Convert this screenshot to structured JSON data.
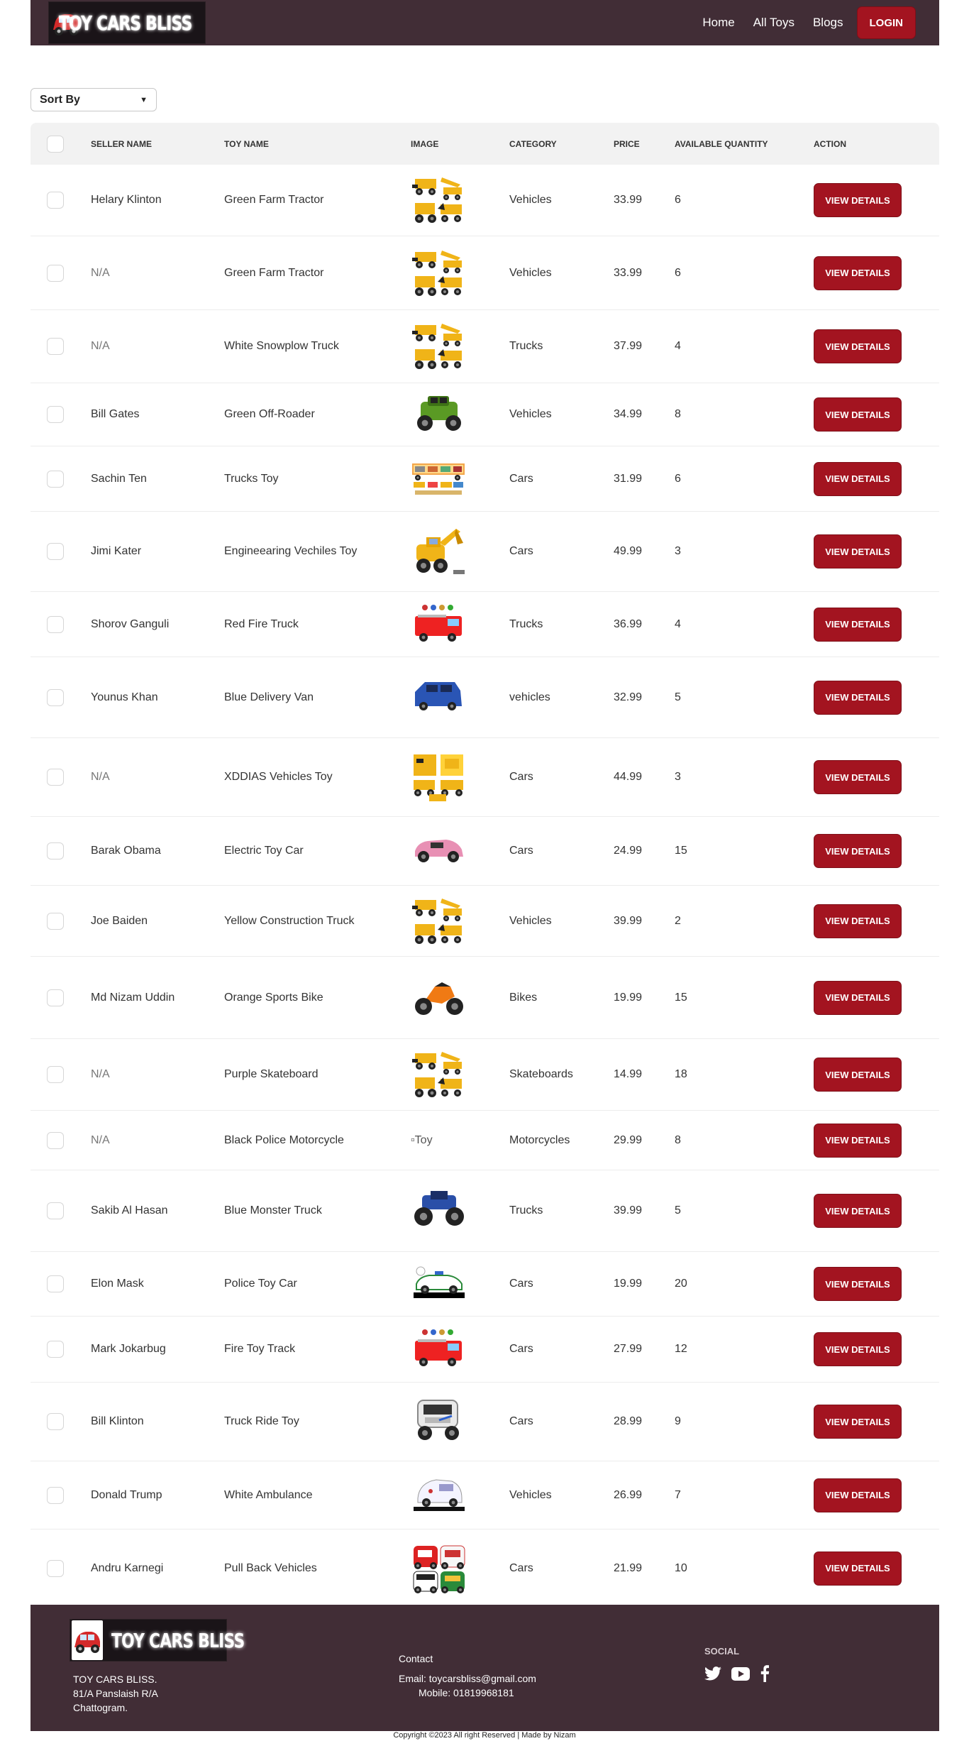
{
  "brand": {
    "name": "TOY CARS BLISS"
  },
  "nav": {
    "links": [
      "Home",
      "All Toys",
      "Blogs"
    ],
    "login_label": "LOGIN"
  },
  "sort": {
    "selected": "Sort By"
  },
  "table": {
    "headers": [
      "SELLER NAME",
      "TOY NAME",
      "IMAGE",
      "CATEGORY",
      "PRICE",
      "AVAILABLE QUANTITY",
      "ACTION"
    ],
    "action_label": "VIEW DETAILS",
    "rows": [
      {
        "seller": "Helary Klinton",
        "toy": "Green Farm Tractor",
        "image": "construction-set",
        "category": "Vehicles",
        "price": "33.99",
        "qty": "6"
      },
      {
        "seller": "N/A",
        "toy": "Green Farm Tractor",
        "image": "construction-set",
        "category": "Vehicles",
        "price": "33.99",
        "qty": "6"
      },
      {
        "seller": "N/A",
        "toy": "White Snowplow Truck",
        "image": "construction-set",
        "category": "Trucks",
        "price": "37.99",
        "qty": "4"
      },
      {
        "seller": "Bill Gates",
        "toy": "Green Off-Roader",
        "image": "green-offroader",
        "category": "Vehicles",
        "price": "34.99",
        "qty": "8"
      },
      {
        "seller": "Sachin Ten",
        "toy": "Trucks Toy",
        "image": "truck-set",
        "category": "Cars",
        "price": "31.99",
        "qty": "6"
      },
      {
        "seller": "Jimi Kater",
        "toy": "Engineearing Vechiles Toy",
        "image": "excavator",
        "category": "Cars",
        "price": "49.99",
        "qty": "3"
      },
      {
        "seller": "Shorov Ganguli",
        "toy": "Red Fire Truck",
        "image": "fire-truck",
        "category": "Trucks",
        "price": "36.99",
        "qty": "4"
      },
      {
        "seller": "Younus Khan",
        "toy": "Blue Delivery Van",
        "image": "blue-van",
        "category": "vehicles",
        "price": "32.99",
        "qty": "5"
      },
      {
        "seller": "N/A",
        "toy": "XDDIAS Vehicles Toy",
        "image": "yellow-vehicles",
        "category": "Cars",
        "price": "44.99",
        "qty": "3"
      },
      {
        "seller": "Barak Obama",
        "toy": "Electric Toy Car",
        "image": "pink-car",
        "category": "Cars",
        "price": "24.99",
        "qty": "15"
      },
      {
        "seller": "Joe Baiden",
        "toy": "Yellow Construction Truck",
        "image": "construction-set",
        "category": "Vehicles",
        "price": "39.99",
        "qty": "2"
      },
      {
        "seller": "Md Nizam Uddin",
        "toy": "Orange Sports Bike",
        "image": "sports-bike",
        "category": "Bikes",
        "price": "19.99",
        "qty": "15"
      },
      {
        "seller": "N/A",
        "toy": "Purple Skateboard",
        "image": "construction-set",
        "category": "Skateboards",
        "price": "14.99",
        "qty": "18"
      },
      {
        "seller": "N/A",
        "toy": "Black Police Motorcycle",
        "image": "broken",
        "image_alt": "Toy",
        "category": "Motorcycles",
        "price": "29.99",
        "qty": "8"
      },
      {
        "seller": "Sakib Al Hasan",
        "toy": "Blue Monster Truck",
        "image": "monster-truck",
        "category": "Trucks",
        "price": "39.99",
        "qty": "5"
      },
      {
        "seller": "Elon Mask",
        "toy": "Police Toy Car",
        "image": "police-car",
        "category": "Cars",
        "price": "19.99",
        "qty": "20"
      },
      {
        "seller": "Mark Jokarbug",
        "toy": "Fire Toy Track",
        "image": "fire-truck",
        "category": "Cars",
        "price": "27.99",
        "qty": "12"
      },
      {
        "seller": "Bill Klinton",
        "toy": "Truck Ride Toy",
        "image": "ride-truck",
        "category": "Cars",
        "price": "28.99",
        "qty": "9"
      },
      {
        "seller": "Donald Trump",
        "toy": "White Ambulance",
        "image": "ambulance",
        "category": "Vehicles",
        "price": "26.99",
        "qty": "7"
      },
      {
        "seller": "Andru Karnegi",
        "toy": "Pull Back Vehicles",
        "image": "pullback-set",
        "category": "Cars",
        "price": "21.99",
        "qty": "10"
      }
    ]
  },
  "footer": {
    "address": [
      "TOY CARS BLISS.",
      "81/A Panslaish R/A",
      "Chattogram."
    ],
    "contact_title": "Contact",
    "email": "Email: toycarsbliss@gmail.com",
    "mobile": "Mobile: 01819968181",
    "social_title": "SOCIAL",
    "social_icons": [
      "twitter-icon",
      "youtube-icon",
      "facebook-icon"
    ],
    "copyright": "Copyright ©2023 All right Reserved | Made by Nizam"
  },
  "colors": {
    "header_bg": "#412d36",
    "accent": "#a31420",
    "table_head_bg": "#f2f2f2"
  }
}
